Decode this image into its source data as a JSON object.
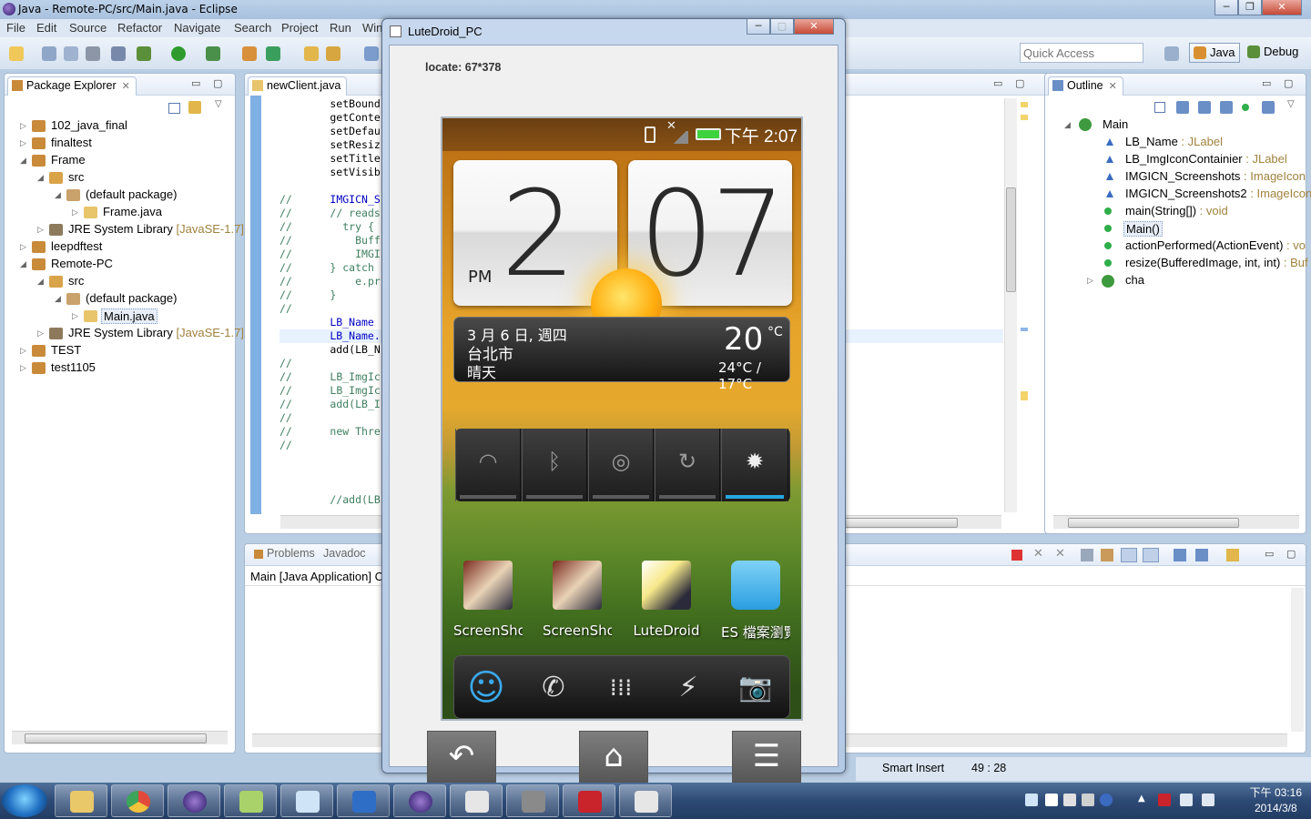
{
  "window": {
    "title": "Java - Remote-PC/src/Main.java - Eclipse"
  },
  "menu": [
    "File",
    "Edit",
    "Source",
    "Refactor",
    "Navigate",
    "Search",
    "Project",
    "Run",
    "Win"
  ],
  "toolbar": {
    "quick_access_placeholder": "Quick Access",
    "perspective_java": "Java",
    "perspective_debug": "Debug"
  },
  "package_explorer": {
    "tab_label": "Package Explorer",
    "rows": [
      {
        "label": "102_java_final",
        "decoration": ""
      },
      {
        "label": "finaltest",
        "decoration": ""
      },
      {
        "label": "Frame",
        "decoration": ""
      },
      {
        "label": "src",
        "decoration": ""
      },
      {
        "label": "(default package)",
        "decoration": ""
      },
      {
        "label": "Frame.java",
        "decoration": ""
      },
      {
        "label": "JRE System Library",
        "decoration": "[JavaSE-1.7]"
      },
      {
        "label": "leepdftest",
        "decoration": ""
      },
      {
        "label": "Remote-PC",
        "decoration": ""
      },
      {
        "label": "src",
        "decoration": ""
      },
      {
        "label": "(default package)",
        "decoration": ""
      },
      {
        "label": "Main.java",
        "decoration": ""
      },
      {
        "label": "JRE System Library",
        "decoration": "[JavaSE-1.7]"
      },
      {
        "label": "TEST",
        "decoration": ""
      },
      {
        "label": "test1105",
        "decoration": ""
      }
    ]
  },
  "editor": {
    "tab_label": "newClient.java",
    "lines": [
      {
        "prefix": "",
        "text": "        setBound"
      },
      {
        "prefix": "",
        "text": "        getConte"
      },
      {
        "prefix": "",
        "text": "        setDefau"
      },
      {
        "prefix": "",
        "text": "        setResiz"
      },
      {
        "prefix": "",
        "text": "        setTitle"
      },
      {
        "prefix": "",
        "text": "        setVisib"
      },
      {
        "prefix": "",
        "text": ""
      },
      {
        "prefix": "//",
        "text": "      IMGICN_S"
      },
      {
        "prefix": "//",
        "text": "      // reads"
      },
      {
        "prefix": "//",
        "text": "        try {"
      },
      {
        "prefix": "//",
        "text": "          Buff"
      },
      {
        "prefix": "//",
        "text": "          IMGI"
      },
      {
        "prefix": "//",
        "text": "      } catch"
      },
      {
        "prefix": "//",
        "text": "          e.pr"
      },
      {
        "prefix": "//",
        "text": "      }"
      },
      {
        "prefix": "//",
        "text": ""
      },
      {
        "prefix": "",
        "text": "        LB_Name"
      },
      {
        "prefix": "",
        "text": "        LB_Name."
      },
      {
        "prefix": "",
        "text": "        add(LB_N"
      },
      {
        "prefix": "//",
        "text": ""
      },
      {
        "prefix": "//",
        "text": "      LB_ImgIc"
      },
      {
        "prefix": "//",
        "text": "      LB_ImgIc"
      },
      {
        "prefix": "//",
        "text": "      add(LB_I"
      },
      {
        "prefix": "//",
        "text": ""
      },
      {
        "prefix": "//",
        "text": "      new Thre"
      },
      {
        "prefix": "//",
        "text": ""
      }
    ],
    "tail_line": "        //add(LB"
  },
  "outline": {
    "tab_label": "Outline",
    "root": "Main",
    "rows": [
      {
        "name": "LB_Name",
        "type": " : JLabel"
      },
      {
        "name": "LB_ImgIconContainier",
        "type": " : JLabel"
      },
      {
        "name": "IMGICN_Screenshots",
        "type": " : ImageIcon"
      },
      {
        "name": "IMGICN_Screenshots2",
        "type": " : ImageIcon"
      },
      {
        "name": "main(String[])",
        "type": " : void"
      },
      {
        "name": "Main()",
        "type": ""
      },
      {
        "name": "actionPerformed(ActionEvent)",
        "type": " : vo"
      },
      {
        "name": "resize(BufferedImage, int, int)",
        "type": " : Buf"
      },
      {
        "name": "cha",
        "type": ""
      }
    ]
  },
  "bottom_panel": {
    "tab_problems": "Problems",
    "tab_javadoc": "Javadoc",
    "console_text": "Main [Java Application] C"
  },
  "status_bar": {
    "insert_mode": "Smart Insert",
    "position": "49 : 28"
  },
  "lutedroid": {
    "title": "LuteDroid_PC",
    "locate": "locate: 67*378",
    "phone": {
      "status_time": "下午 2:07",
      "clock_hour": "2",
      "clock_minute": "07",
      "clock_ampm": "PM",
      "weather_date": "3 月 6 日, 週四",
      "weather_city": "台北市",
      "weather_cond": "晴天",
      "weather_temp": "20",
      "weather_unit": "°C",
      "weather_range": "24°C / 17°C",
      "quick_settings": [
        "wifi-icon",
        "bluetooth-icon",
        "gps-icon",
        "sync-icon",
        "brightness-icon"
      ],
      "apps": [
        "ScreenShot",
        "ScreenShot",
        "LuteDroid",
        "ES 檔案瀏覽"
      ],
      "dock": [
        "people-icon",
        "phone-icon",
        "app-drawer-icon",
        "flashlight-icon",
        "camera-icon"
      ]
    },
    "nav": [
      "back-icon",
      "home-icon",
      "menu-icon"
    ]
  },
  "taskbar": {
    "time": "下午 03:16",
    "date": "2014/3/8",
    "apps": [
      "file-explorer-icon",
      "chrome-icon",
      "eclipse-icon",
      "notepad-icon",
      "app-icon",
      "word-icon",
      "eclipse-icon",
      "java-icon",
      "camera-app-icon",
      "pdf-icon",
      "java-icon"
    ]
  },
  "colors": {
    "titlebar": "#b7cde6",
    "comment": "#3f7f5f",
    "field": "#0000c0",
    "type_decoration": "#a0823c"
  }
}
